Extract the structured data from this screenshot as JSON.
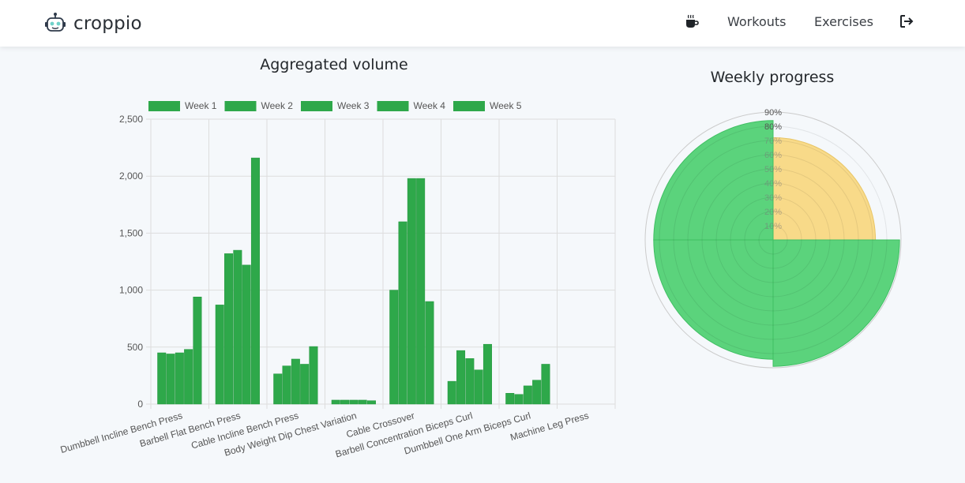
{
  "app": {
    "name": "croppio",
    "nav": {
      "workouts": "Workouts",
      "exercises": "Exercises"
    },
    "icons": {
      "logo": "robot-icon",
      "coffee": "coffee-icon",
      "logout": "logout-icon"
    }
  },
  "colors": {
    "bar": "#2ea84a",
    "polar_green": "#4dcf71",
    "polar_yellow": "#f7d77f",
    "grid": "#dddddd",
    "background": "#f5f8fb"
  },
  "chart_data": [
    {
      "type": "bar",
      "title": "Aggregated volume",
      "categories": [
        "Dumbbell Incline Bench Press",
        "Barbell Flat Bench Press",
        "Cable Incline Bench Press",
        "Body Weight Dip Chest Variation",
        "Cable Crossover",
        "Barbell Concentration Biceps Curl",
        "Dumbbell One Arm Biceps Curl",
        "Machine Leg Press"
      ],
      "series": [
        {
          "name": "Week 1",
          "values": [
            450,
            870,
            265,
            35,
            1000,
            200,
            95,
            0
          ]
        },
        {
          "name": "Week 2",
          "values": [
            440,
            1320,
            335,
            35,
            1600,
            470,
            85,
            0
          ]
        },
        {
          "name": "Week 3",
          "values": [
            450,
            1350,
            395,
            35,
            1980,
            400,
            160,
            0
          ]
        },
        {
          "name": "Week 4",
          "values": [
            480,
            1220,
            350,
            35,
            1980,
            300,
            210,
            0
          ]
        },
        {
          "name": "Week 5",
          "values": [
            940,
            2160,
            505,
            30,
            900,
            525,
            350,
            0
          ]
        }
      ],
      "ylim": [
        0,
        2500
      ],
      "yticks": [
        "0",
        "500",
        "1,000",
        "1,500",
        "2,000",
        "2,500"
      ],
      "grid": true,
      "legend": "top"
    },
    {
      "type": "polar-area",
      "title": "Weekly progress",
      "values": [
        72,
        89,
        84,
        84
      ],
      "rlim": [
        0,
        90
      ],
      "rticks": [
        "10%",
        "20%",
        "30%",
        "40%",
        "50%",
        "60%",
        "70%",
        "80%",
        "90%"
      ],
      "slice_colors": [
        "#f7d77f",
        "#4dcf71",
        "#4dcf71",
        "#4dcf71"
      ],
      "grid": true
    }
  ]
}
